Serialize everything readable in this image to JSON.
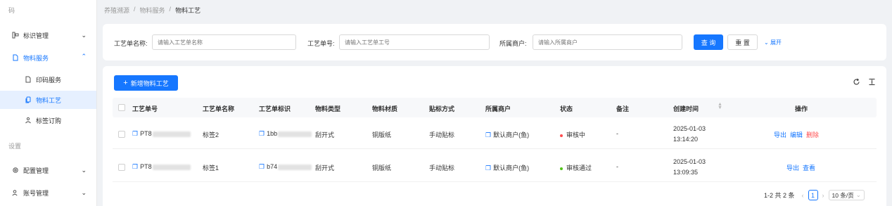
{
  "sidebar": {
    "header": "码",
    "items": [
      {
        "label": "标识管理",
        "icon": "tag-icon"
      },
      {
        "label": "物料服务",
        "icon": "file-icon"
      },
      {
        "label": "印码服务",
        "icon": "file-icon"
      },
      {
        "label": "物料工艺",
        "icon": "copy-icon"
      },
      {
        "label": "标签订购",
        "icon": "people-icon"
      }
    ],
    "section_settings": "设置",
    "settings_items": [
      {
        "label": "配置管理",
        "icon": "gear-icon"
      },
      {
        "label": "账号管理",
        "icon": "user-icon"
      }
    ]
  },
  "breadcrumb": [
    "养殖溯源",
    "物料服务",
    "物料工艺"
  ],
  "search": {
    "name_label": "工艺单名称:",
    "name_placeholder": "请输入工艺单名称",
    "no_label": "工艺单号:",
    "no_placeholder": "请输入工艺单工号",
    "merchant_label": "所属商户:",
    "merchant_placeholder": "请输入所属商户",
    "query_label": "查 询",
    "reset_label": "重 置",
    "expand_label": "展开"
  },
  "toolbar": {
    "add_label": "新增物料工艺"
  },
  "table": {
    "columns": [
      "工艺单号",
      "工艺单名称",
      "工艺单标识",
      "物料类型",
      "物料材质",
      "贴标方式",
      "所属商户",
      "状态",
      "备注",
      "创建时间",
      "操作"
    ],
    "rows": [
      {
        "no": "PT8",
        "name": "标签2",
        "ident": "1bb",
        "type": "刮开式",
        "material": "铜版纸",
        "method": "手动贴标",
        "merchant": "默认商户(鱼)",
        "status": "审核中",
        "status_color": "#ff4d4f",
        "remark": "-",
        "date": "2025-01-03",
        "time": "13:14:20",
        "actions": [
          "导出",
          "编辑",
          "删除"
        ]
      },
      {
        "no": "PT8",
        "name": "标签1",
        "ident": "b74",
        "type": "刮开式",
        "material": "铜版纸",
        "method": "手动贴标",
        "merchant": "默认商户(鱼)",
        "status": "审核通过",
        "status_color": "#52c41a",
        "remark": "-",
        "date": "2025-01-03",
        "time": "13:09:35",
        "actions": [
          "导出",
          "查看"
        ]
      }
    ]
  },
  "pagination": {
    "summary": "1-2 共 2 条",
    "current": "1",
    "page_size": "10 条/页"
  },
  "colors": {
    "primary": "#1677ff",
    "danger": "#ff4d4f",
    "success": "#52c41a"
  }
}
